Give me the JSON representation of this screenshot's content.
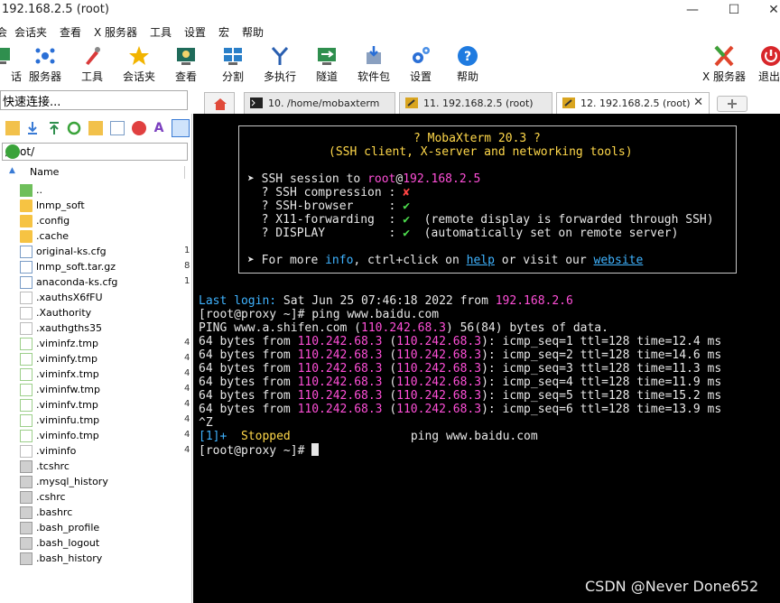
{
  "window": {
    "title": "192.168.2.5 (root)",
    "minimize": "—",
    "maximize": "☐",
    "close": "✕"
  },
  "menu": [
    "会话夹",
    "查看",
    "X 服务器",
    "工具",
    "设置",
    "宏",
    "帮助"
  ],
  "menu_partial": "会",
  "toolbar": {
    "items": [
      "服务器",
      "工具",
      "会话夹",
      "查看",
      "分割",
      "多执行",
      "隧道",
      "软件包",
      "设置",
      "帮助"
    ],
    "partial_left": "话",
    "right": [
      "X 服务器",
      "退出"
    ]
  },
  "quick_connect": {
    "value": "快速连接..."
  },
  "tabs": [
    {
      "label": "10. /home/mobaxterm",
      "active": false
    },
    {
      "label": "11. 192.168.2.5 (root)",
      "active": false
    },
    {
      "label": "12. 192.168.2.5 (root)",
      "active": true
    }
  ],
  "sidebar": {
    "path": "/root/",
    "column": "Name",
    "files": [
      {
        "name": "..",
        "type": "up",
        "size": ""
      },
      {
        "name": "lnmp_soft",
        "type": "folder",
        "size": ""
      },
      {
        "name": ".config",
        "type": "folder",
        "size": ""
      },
      {
        "name": ".cache",
        "type": "folder",
        "size": ""
      },
      {
        "name": "original-ks.cfg",
        "type": "doc",
        "size": "1"
      },
      {
        "name": "lnmp_soft.tar.gz",
        "type": "doc",
        "size": "8"
      },
      {
        "name": "anaconda-ks.cfg",
        "type": "doc",
        "size": "1"
      },
      {
        "name": ".xauthsX6fFU",
        "type": "blank",
        "size": ""
      },
      {
        "name": ".Xauthority",
        "type": "blank",
        "size": ""
      },
      {
        "name": ".xauthgths35",
        "type": "blank",
        "size": ""
      },
      {
        "name": ".viminfz.tmp",
        "type": "tmp",
        "size": "4"
      },
      {
        "name": ".viminfy.tmp",
        "type": "tmp",
        "size": "4"
      },
      {
        "name": ".viminfx.tmp",
        "type": "tmp",
        "size": "4"
      },
      {
        "name": ".viminfw.tmp",
        "type": "tmp",
        "size": "4"
      },
      {
        "name": ".viminfv.tmp",
        "type": "tmp",
        "size": "4"
      },
      {
        "name": ".viminfu.tmp",
        "type": "tmp",
        "size": "4"
      },
      {
        "name": ".viminfo.tmp",
        "type": "tmp",
        "size": "4"
      },
      {
        "name": ".viminfo",
        "type": "blank",
        "size": "4"
      },
      {
        "name": ".tcshrc",
        "type": "sys",
        "size": ""
      },
      {
        "name": ".mysql_history",
        "type": "sys",
        "size": ""
      },
      {
        "name": ".cshrc",
        "type": "sys",
        "size": ""
      },
      {
        "name": ".bashrc",
        "type": "sys",
        "size": ""
      },
      {
        "name": ".bash_profile",
        "type": "sys",
        "size": ""
      },
      {
        "name": ".bash_logout",
        "type": "sys",
        "size": ""
      },
      {
        "name": ".bash_history",
        "type": "sys",
        "size": ""
      }
    ]
  },
  "terminal": {
    "banner": {
      "title": "? MobaXterm 20.3 ?",
      "subtitle": "(SSH client, X-server and networking tools)",
      "ssh_prefix": "➤ SSH session to ",
      "ssh_user": "root",
      "ssh_at": "@",
      "ssh_host": "192.168.2.5",
      "compression": "  ? SSH compression : ",
      "compression_val": "✘",
      "browser": "  ? SSH-browser     : ",
      "browser_val": "✔",
      "x11": "  ? X11-forwarding  : ",
      "x11_val": "✔",
      "x11_note": "  (remote display is forwarded through SSH)",
      "display": "  ? DISPLAY         : ",
      "display_val": "✔",
      "display_note": "  (automatically set on remote server)",
      "more_prefix": "➤ For more ",
      "more_info": "info",
      "more_mid": ", ctrl+click on ",
      "more_help": "help",
      "more_or": " or visit our ",
      "more_site": "website"
    },
    "last_login_label": "Last login:",
    "last_login_text": " Sat Jun 25 07:46:18 2022 from ",
    "last_login_ip": "192.168.2.6",
    "prompt1": "[root@proxy ~]# ping www.baidu.com",
    "ping_head_a": "PING www.a.shifen.com (",
    "ping_head_ip": "110.242.68.3",
    "ping_head_b": ") 56(84) bytes of data.",
    "ping_rows": [
      {
        "prefix": "64 bytes from ",
        "ip": "110.242.68.3",
        "mid": " (",
        "ip2": "110.242.68.3",
        "rest": "): icmp_seq=1 ttl=128 time=12.4 ms"
      },
      {
        "prefix": "64 bytes from ",
        "ip": "110.242.68.3",
        "mid": " (",
        "ip2": "110.242.68.3",
        "rest": "): icmp_seq=2 ttl=128 time=14.6 ms"
      },
      {
        "prefix": "64 bytes from ",
        "ip": "110.242.68.3",
        "mid": " (",
        "ip2": "110.242.68.3",
        "rest": "): icmp_seq=3 ttl=128 time=11.3 ms"
      },
      {
        "prefix": "64 bytes from ",
        "ip": "110.242.68.3",
        "mid": " (",
        "ip2": "110.242.68.3",
        "rest": "): icmp_seq=4 ttl=128 time=11.9 ms"
      },
      {
        "prefix": "64 bytes from ",
        "ip": "110.242.68.3",
        "mid": " (",
        "ip2": "110.242.68.3",
        "rest": "): icmp_seq=5 ttl=128 time=15.2 ms"
      },
      {
        "prefix": "64 bytes from ",
        "ip": "110.242.68.3",
        "mid": " (",
        "ip2": "110.242.68.3",
        "rest": "): icmp_seq=6 ttl=128 time=13.9 ms"
      }
    ],
    "ctrl_z": "^Z",
    "job_num": "[1]+",
    "job_status": "  Stopped",
    "job_cmd": "                 ping www.baidu.com",
    "prompt2": "[root@proxy ~]# "
  },
  "watermark": "CSDN @Never Done652"
}
